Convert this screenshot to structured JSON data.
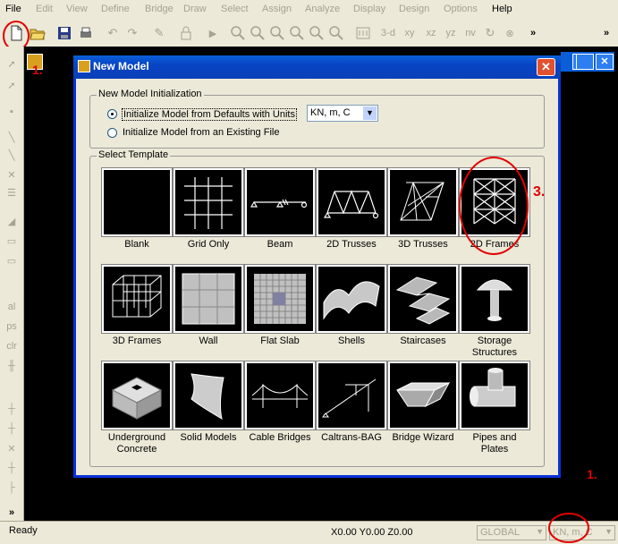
{
  "menu": [
    "File",
    "Edit",
    "View",
    "Define",
    "Bridge",
    "Draw",
    "Select",
    "Assign",
    "Analyze",
    "Display",
    "Design",
    "Options",
    "Help"
  ],
  "dialog": {
    "title": "New Model",
    "init_group_label": "New Model Initialization",
    "radio_defaults": "Initialize Model from Defaults with Units",
    "radio_existing": "Initialize Model  from an Existing File",
    "units_value": "KN, m, C",
    "template_group_label": "Select Template",
    "templates": [
      {
        "label": "Blank",
        "icon": "blank-icon"
      },
      {
        "label": "Grid Only",
        "icon": "grid-icon"
      },
      {
        "label": "Beam",
        "icon": "beam-icon"
      },
      {
        "label": "2D Trusses",
        "icon": "truss-2d-icon"
      },
      {
        "label": "3D Trusses",
        "icon": "truss-3d-icon"
      },
      {
        "label": "2D Frames",
        "icon": "frame-2d-icon"
      },
      {
        "label": "3D Frames",
        "icon": "frame-3d-icon"
      },
      {
        "label": "Wall",
        "icon": "wall-icon"
      },
      {
        "label": "Flat Slab",
        "icon": "flat-slab-icon"
      },
      {
        "label": "Shells",
        "icon": "shells-icon"
      },
      {
        "label": "Staircases",
        "icon": "staircase-icon"
      },
      {
        "label": "Storage Structures",
        "icon": "storage-icon"
      },
      {
        "label": "Underground Concrete",
        "icon": "underground-icon"
      },
      {
        "label": "Solid Models",
        "icon": "solid-icon"
      },
      {
        "label": "Cable Bridges",
        "icon": "cable-bridge-icon"
      },
      {
        "label": "Caltrans-BAG",
        "icon": "caltrans-icon"
      },
      {
        "label": "Bridge Wizard",
        "icon": "bridge-wizard-icon"
      },
      {
        "label": "Pipes and Plates",
        "icon": "pipes-icon"
      }
    ]
  },
  "toolbar": {
    "view_3d": "3-d",
    "view_xy": "xy",
    "view_xz": "xz",
    "view_yz": "yz",
    "view_nv": "nv"
  },
  "status": {
    "ready": "Ready",
    "coords": "X0.00  Y0.00  Z0.00",
    "coord_system": "GLOBAL",
    "units": "KN, m, C"
  },
  "annotations": {
    "a1": "1.",
    "a3": "3.",
    "a1b": "1."
  },
  "colors": {
    "titlebar": "#0a5fd8",
    "annotation": "#e00000",
    "dialog_bg": "#ece9d8"
  }
}
